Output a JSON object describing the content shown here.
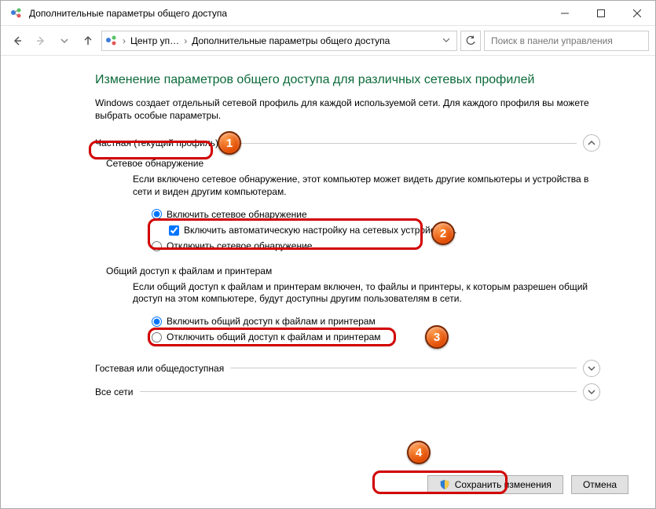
{
  "titlebar": {
    "title": "Дополнительные параметры общего доступа"
  },
  "breadcrumbs": {
    "seg1": "Центр уп…",
    "seg2": "Дополнительные параметры общего доступа"
  },
  "search": {
    "placeholder": "Поиск в панели управления"
  },
  "page": {
    "title": "Изменение параметров общего доступа для различных сетевых профилей",
    "subtitle": "Windows создает отдельный сетевой профиль для каждой используемой сети. Для каждого профиля вы можете выбрать особые параметры."
  },
  "sections": {
    "private": {
      "label": "Частная (текущий профиль)",
      "discovery": {
        "heading": "Сетевое обнаружение",
        "body": "Если включено сетевое обнаружение, этот компьютер может видеть другие компьютеры и устройства в сети и виден другим компьютерам.",
        "opt_on": "Включить сетевое обнаружение",
        "opt_on_sub": "Включить автоматическую настройку на сетевых устройствах.",
        "opt_off": "Отключить сетевое обнаружение"
      },
      "sharing": {
        "heading": "Общий доступ к файлам и принтерам",
        "body": "Если общий доступ к файлам и принтерам включен, то файлы и принтеры, к которым разрешен общий доступ на этом компьютере, будут доступны другим пользователям в сети.",
        "opt_on": "Включить общий доступ к файлам и принтерам",
        "opt_off": "Отключить общий доступ к файлам и принтерам"
      }
    },
    "guest": {
      "label": "Гостевая или общедоступная"
    },
    "all": {
      "label": "Все сети"
    }
  },
  "footer": {
    "save": "Сохранить изменения",
    "cancel": "Отмена"
  },
  "callouts": {
    "n1": "1",
    "n2": "2",
    "n3": "3",
    "n4": "4"
  }
}
